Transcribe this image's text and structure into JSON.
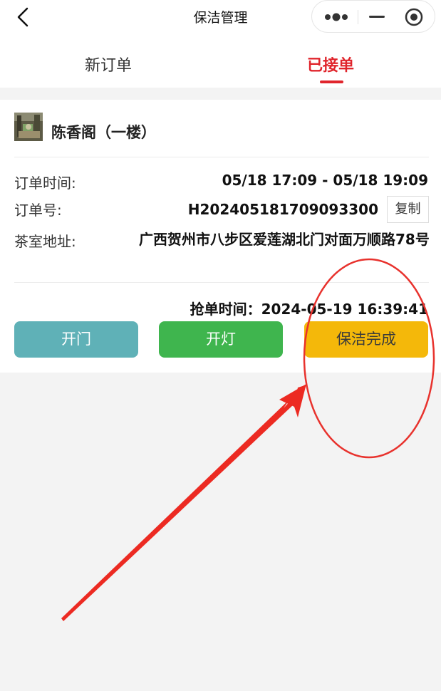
{
  "nav": {
    "title": "保洁管理"
  },
  "tabs": [
    {
      "label": "新订单",
      "active": false
    },
    {
      "label": "已接单",
      "active": true
    }
  ],
  "order": {
    "shop_name": "陈香阁（一楼）",
    "time_label": "订单时间:",
    "time_value": "05/18 17:09 - 05/18 19:09",
    "number_label": "订单号:",
    "number_value": "H202405181709093300",
    "copy_label": "复制",
    "address_label": "茶室地址:",
    "address_value": "广西贺州市八步区爱莲湖北门对面万顺路78号",
    "grab_time": "抢单时间：2024-05-19 16:39:41"
  },
  "actions": {
    "open_door": "开门",
    "light": "开灯",
    "cleaning_done": "保洁完成"
  },
  "colors": {
    "accent_red": "#e0252c",
    "open_door_bg": "#5fb1b7",
    "light_bg": "#3fb54e",
    "done_bg": "#f4b80a",
    "annotation_red": "#e8322d"
  },
  "icons": {
    "back": "chevron-left-icon",
    "more": "more-dots-icon",
    "minimize": "minimize-icon",
    "close": "target-circle-icon"
  }
}
